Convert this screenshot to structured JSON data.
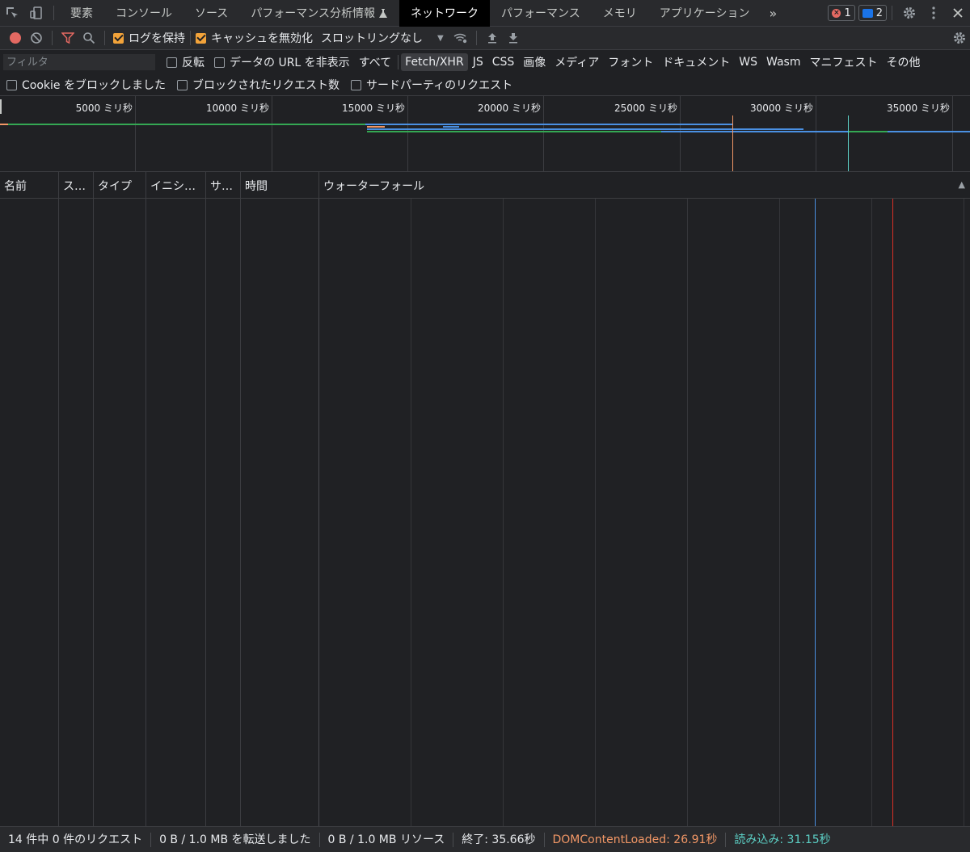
{
  "tabs": {
    "items": [
      "要素",
      "コンソール",
      "ソース",
      "パフォーマンス分析情報",
      "ネットワーク",
      "パフォーマンス",
      "メモリ",
      "アプリケーション"
    ],
    "more": "»",
    "errors_count": "1",
    "messages_count": "2"
  },
  "toolbar": {
    "preserve_log": "ログを保持",
    "disable_cache": "キャッシュを無効化",
    "throttling": "スロットリングなし"
  },
  "filter": {
    "placeholder": "フィルタ",
    "invert": "反転",
    "hide_data_urls": "データの URL を非表示",
    "types": [
      "すべて",
      "Fetch/XHR",
      "JS",
      "CSS",
      "画像",
      "メディア",
      "フォント",
      "ドキュメント",
      "WS",
      "Wasm",
      "マニフェスト",
      "その他"
    ],
    "active_type": "Fetch/XHR"
  },
  "block": {
    "blocked_cookies": "Cookie をブロックしました",
    "blocked_requests": "ブロックされたリクエスト数",
    "third_party": "サードパーティのリクエスト"
  },
  "overview": {
    "ticks": [
      "5000 ミリ秒",
      "10000 ミリ秒",
      "15000 ミリ秒",
      "20000 ミリ秒",
      "25000 ミリ秒",
      "30000 ミリ秒",
      "35000 ミリ秒"
    ]
  },
  "columns": {
    "name": "名前",
    "status": "ス…",
    "type": "タイプ",
    "initiator": "イニシ…",
    "size": "サ…",
    "time": "時間",
    "waterfall": "ウォーターフォール"
  },
  "status": {
    "requests": "14 件中 0 件のリクエスト",
    "transferred": "0 B / 1.0 MB を転送しました",
    "resources": "0 B / 1.0 MB リソース",
    "finish": "終了: 35.66秒",
    "dom_content_loaded": "DOMContentLoaded: 26.91秒",
    "load": "読み込み: 31.15秒"
  },
  "colors": {
    "dom_content_loaded": "#f29766",
    "load": "#5ccfc5",
    "accent_checkbox": "#f2a33a",
    "record": "#e46962"
  }
}
